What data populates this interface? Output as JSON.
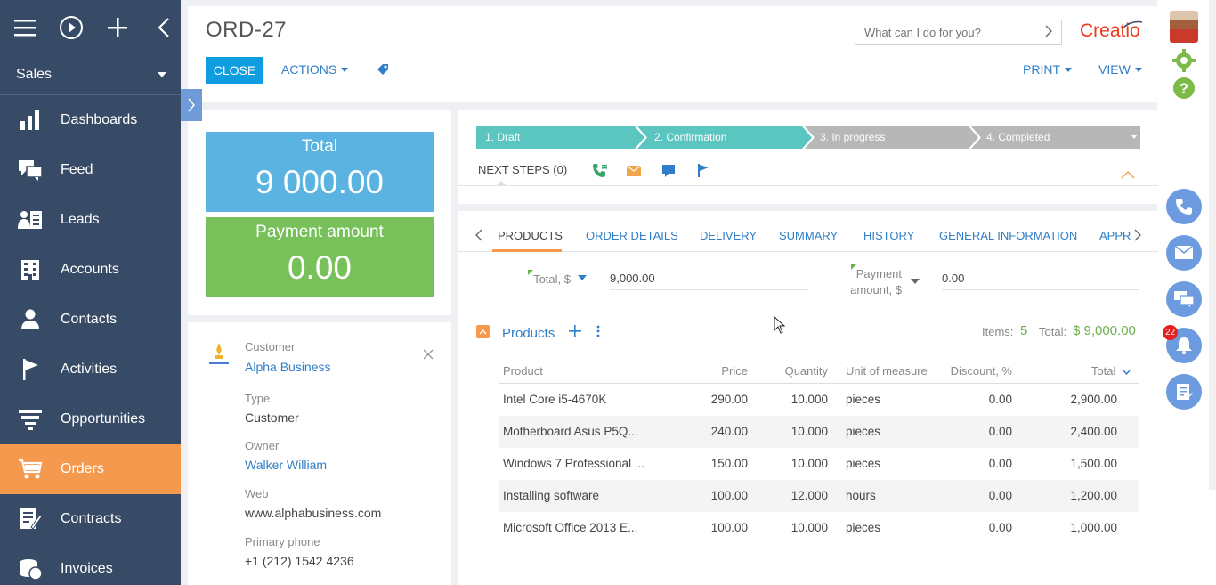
{
  "sidebar": {
    "workspace": "Sales",
    "items": [
      {
        "label": "Dashboards"
      },
      {
        "label": "Feed"
      },
      {
        "label": "Leads"
      },
      {
        "label": "Accounts"
      },
      {
        "label": "Contacts"
      },
      {
        "label": "Activities"
      },
      {
        "label": "Opportunities"
      },
      {
        "label": "Orders"
      },
      {
        "label": "Contracts"
      },
      {
        "label": "Invoices"
      }
    ],
    "active_item": "Orders"
  },
  "header": {
    "title": "ORD-27",
    "close_label": "CLOSE",
    "actions_label": "ACTIONS",
    "print_label": "PRINT",
    "view_label": "VIEW",
    "search_placeholder": "What can I do for you?",
    "logo": "Creatio"
  },
  "summary": {
    "total_label": "Total",
    "total_value": "9 000.00",
    "payment_label": "Payment amount",
    "payment_value": "0.00"
  },
  "profile": {
    "customer_label": "Customer",
    "customer_value": "Alpha Business",
    "type_label": "Type",
    "type_value": "Customer",
    "owner_label": "Owner",
    "owner_value": "Walker William",
    "web_label": "Web",
    "web_value": "www.alphabusiness.com",
    "phone_label": "Primary phone",
    "phone_value": "+1 (212) 1542 4236"
  },
  "stages": {
    "items": [
      {
        "label": "1. Draft",
        "state": "done"
      },
      {
        "label": "2. Confirmation",
        "state": "current"
      },
      {
        "label": "3. In progress",
        "state": "todo"
      },
      {
        "label": "4. Completed",
        "state": "todo"
      }
    ],
    "next_steps_label": "NEXT STEPS (0)",
    "done_color": "#5bc5c0",
    "todo_color": "#b7b7b7"
  },
  "tabs": {
    "items": [
      {
        "label": "PRODUCTS"
      },
      {
        "label": "ORDER DETAILS"
      },
      {
        "label": "DELIVERY"
      },
      {
        "label": "SUMMARY"
      },
      {
        "label": "HISTORY"
      },
      {
        "label": "GENERAL INFORMATION"
      },
      {
        "label": "APPRO"
      }
    ],
    "active": "PRODUCTS"
  },
  "fields": {
    "total_label": "Total, $",
    "total_value": "9,000.00",
    "payment_label_1": "Payment",
    "payment_label_2": "amount, $",
    "payment_value": "0.00"
  },
  "products": {
    "title": "Products",
    "items_label": "Items:",
    "items_count": "5",
    "total_label": "Total:",
    "total_value": "$  9,000.00",
    "columns": [
      "Product",
      "Price",
      "Quantity",
      "Unit of measure",
      "Discount, %",
      "Total"
    ],
    "rows": [
      {
        "product": "Intel Core i5-4670K",
        "price": "290.00",
        "qty": "10.000",
        "uom": "pieces",
        "disc": "0.00",
        "total": "2,900.00"
      },
      {
        "product": "Motherboard Asus P5Q...",
        "price": "240.00",
        "qty": "10.000",
        "uom": "pieces",
        "disc": "0.00",
        "total": "2,400.00"
      },
      {
        "product": "Windows 7 Professional ...",
        "price": "150.00",
        "qty": "10.000",
        "uom": "pieces",
        "disc": "0.00",
        "total": "1,500.00"
      },
      {
        "product": "Installing software",
        "price": "100.00",
        "qty": "12.000",
        "uom": "hours",
        "disc": "0.00",
        "total": "1,200.00"
      },
      {
        "product": "Microsoft Office 2013 E...",
        "price": "100.00",
        "qty": "10.000",
        "uom": "pieces",
        "disc": "0.00",
        "total": "1,000.00"
      }
    ]
  },
  "rail": {
    "notification_count": "22"
  },
  "colors": {
    "sidebar_bg": "#384b66",
    "accent_orange": "#f5994f",
    "primary_blue": "#0d9de0",
    "link_blue": "#2f7ec7",
    "kpi_blue": "#5ab3e0",
    "kpi_green": "#78c05a"
  }
}
